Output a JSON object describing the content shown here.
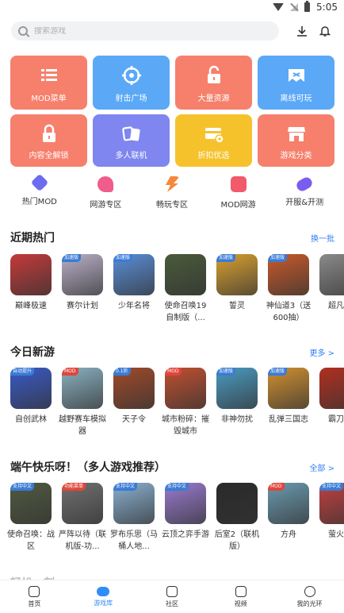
{
  "status_bar": {
    "time": "5:05"
  },
  "search": {
    "placeholder": "搜索游戏"
  },
  "tiles": [
    {
      "label": "MOD菜单",
      "color": "#f6806c",
      "icon": "list-icon"
    },
    {
      "label": "射击广场",
      "color": "#5ba8f7",
      "icon": "crosshair-icon"
    },
    {
      "label": "大量资源",
      "color": "#f6806c",
      "icon": "unlock-icon"
    },
    {
      "label": "离线可玩",
      "color": "#5ba8f7",
      "icon": "offline-icon"
    },
    {
      "label": "内容全解锁",
      "color": "#f6806c",
      "icon": "lock-open-icon"
    },
    {
      "label": "多人联机",
      "color": "#7f86f0",
      "icon": "cards-icon"
    },
    {
      "label": "折扣优选",
      "color": "#f6c22c",
      "icon": "discount-card-icon"
    },
    {
      "label": "游戏分类",
      "color": "#f6806c",
      "icon": "store-icon"
    }
  ],
  "shortcuts": [
    {
      "label": "热门MOD",
      "color": "#6b6cf0"
    },
    {
      "label": "网游专区",
      "color": "#f05c8c"
    },
    {
      "label": "畅玩专区",
      "color": "#f6883a"
    },
    {
      "label": "MOD网游",
      "color": "#f05a6a"
    },
    {
      "label": "开服&开测",
      "color": "#7a5cf0"
    }
  ],
  "sections": {
    "recent": {
      "title": "近期热门",
      "more": "换一批",
      "games": [
        {
          "name": "巅峰极速",
          "badge": "",
          "color": "#c43a3a"
        },
        {
          "name": "赛尔计划",
          "badge": "加速版",
          "color": "#b9b0c8"
        },
        {
          "name": "少年名将",
          "badge": "加速版",
          "color": "#5a8ed8"
        },
        {
          "name": "使命召唤19自制版（...",
          "badge": "",
          "color": "#4a5a3a"
        },
        {
          "name": "誓灵",
          "badge": "加速版",
          "color": "#d8a030"
        },
        {
          "name": "神仙道3（送600抽）",
          "badge": "加速版",
          "color": "#c85a2a"
        },
        {
          "name": "超凡先",
          "badge": "",
          "color": "#8a8a8a"
        }
      ]
    },
    "new_today": {
      "title": "今日新游",
      "more": "更多 >",
      "games": [
        {
          "name": "自创武林",
          "badge": "自动提升",
          "color": "#3a5ac8"
        },
        {
          "name": "越野赛车模拟器",
          "badge": "MOD",
          "color": "#8ab0c0"
        },
        {
          "name": "天子令",
          "badge": "0.1折",
          "color": "#a04a2a"
        },
        {
          "name": "城市粉碎：摧毁城市",
          "badge": "MOD",
          "color": "#c05030"
        },
        {
          "name": "非神勿扰",
          "badge": "加速版",
          "color": "#4a9ac0"
        },
        {
          "name": "乱弹三国志",
          "badge": "加速版",
          "color": "#d09030"
        },
        {
          "name": "霸刀传",
          "badge": "",
          "color": "#b03020"
        }
      ]
    },
    "festival": {
      "title": "端午快乐呀！（多人游戏推荐）",
      "more": "全部 >",
      "games": [
        {
          "name": "使命召唤：战区",
          "badge": "支持中文",
          "color": "#505a40"
        },
        {
          "name": "严阵以待（联机版-功...",
          "badge": "功能菜单",
          "color": "#707070"
        },
        {
          "name": "罗布乐思（马桶人地...",
          "badge": "支持中文",
          "color": "#8ab0d0"
        },
        {
          "name": "云顶之弈手游",
          "badge": "支持中文",
          "color": "#9a7ad0"
        },
        {
          "name": "后室2（联机版）",
          "badge": "",
          "color": "#2a2a2a"
        },
        {
          "name": "方舟",
          "badge": "MOD",
          "color": "#6a9ab0"
        },
        {
          "name": "萤火突",
          "badge": "支持中文",
          "color": "#c04040"
        }
      ]
    },
    "partial": {
      "title": "轻松一刻"
    }
  },
  "bottom_nav": [
    {
      "label": "首页",
      "active": false
    },
    {
      "label": "游戏库",
      "active": true
    },
    {
      "label": "社区",
      "active": false
    },
    {
      "label": "视频",
      "active": false
    },
    {
      "label": "我的光环",
      "active": false
    }
  ]
}
